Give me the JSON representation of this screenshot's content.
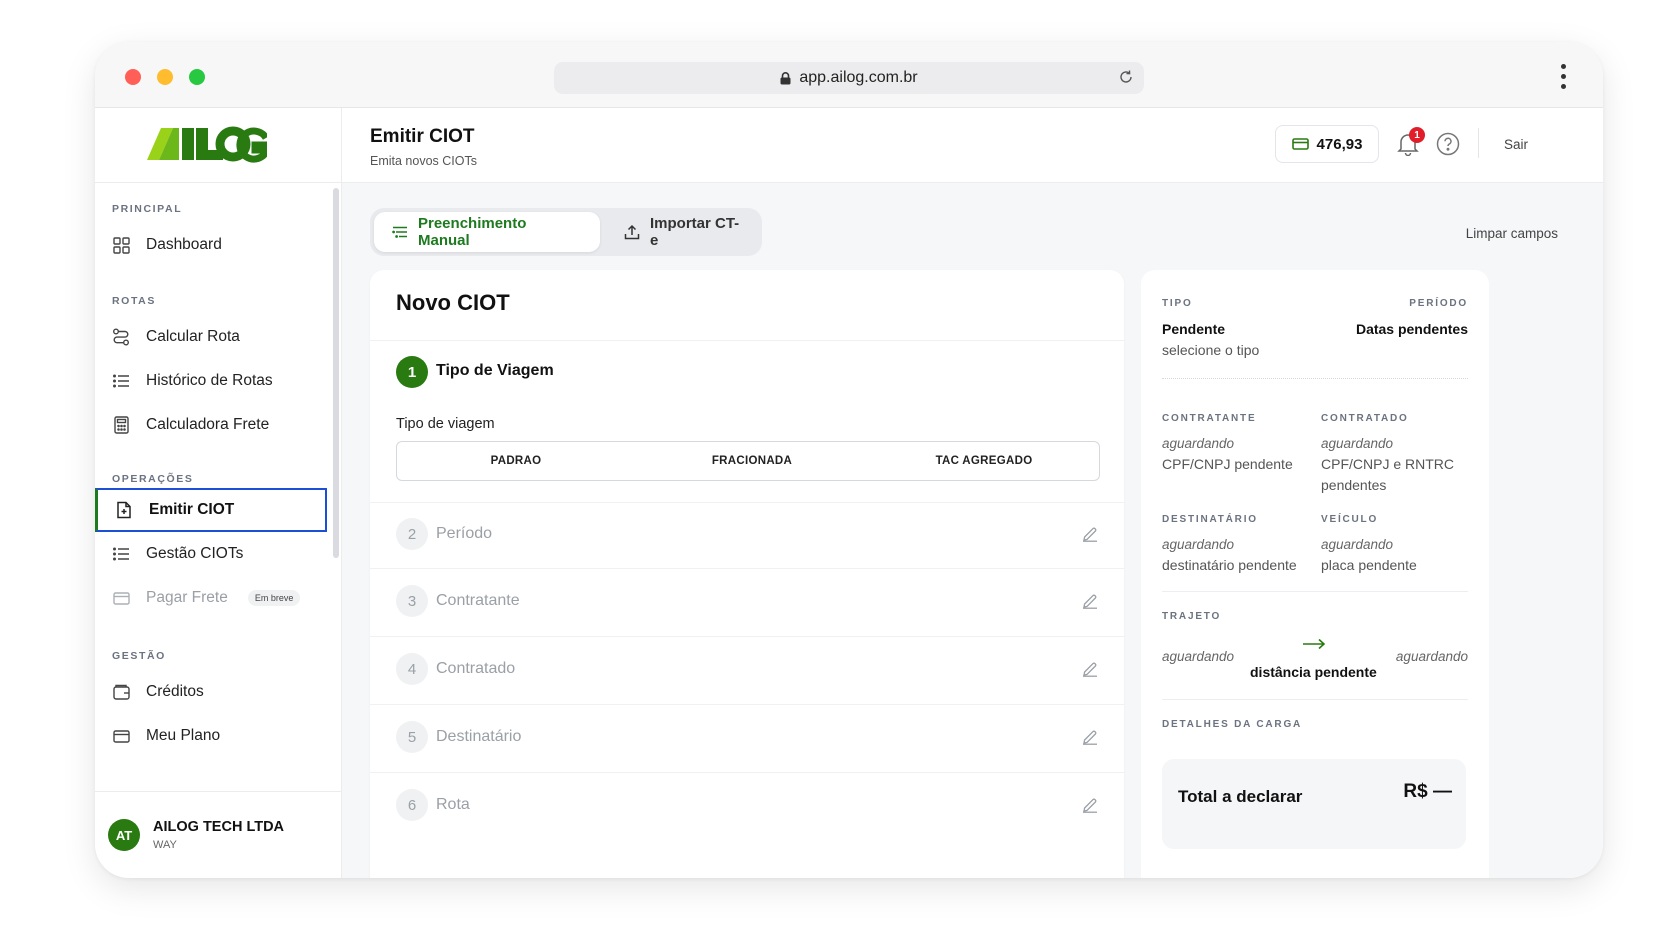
{
  "browser": {
    "url": "app.ailog.com.br"
  },
  "brand": {
    "logo_text": "AILOG",
    "green": "#2a7a12",
    "lime": "#9ad21a"
  },
  "sidebar": {
    "sections": {
      "principal": "PRINCIPAL",
      "rotas": "ROTAS",
      "operacoes": "OPERAÇÕES",
      "gestao": "GESTÃO"
    },
    "items": [
      {
        "label": "Dashboard",
        "icon": "grid-icon"
      },
      {
        "label": "Calcular Rota",
        "icon": "route-icon"
      },
      {
        "label": "Histórico de Rotas",
        "icon": "list-icon"
      },
      {
        "label": "Calculadora Frete",
        "icon": "calculator-icon"
      },
      {
        "label": "Emitir CIOT",
        "icon": "file-plus-icon",
        "active": true
      },
      {
        "label": "Gestão CIOTs",
        "icon": "list-icon"
      },
      {
        "label": "Pagar Frete",
        "icon": "card-icon",
        "disabled": true,
        "badge": "Em breve"
      },
      {
        "label": "Créditos",
        "icon": "wallet-icon"
      },
      {
        "label": "Meu Plano",
        "icon": "card-icon"
      }
    ],
    "org": {
      "initials": "AT",
      "name": "AILOG TECH LTDA",
      "sub": "WAY"
    }
  },
  "header": {
    "title": "Emitir CIOT",
    "subtitle": "Emita novos CIOTs",
    "balance": "476,93",
    "notifications": "1",
    "logout": "Sair"
  },
  "tabs": [
    {
      "label": "Preenchimento Manual",
      "active": true
    },
    {
      "label": "Importar CT-e",
      "active": false
    }
  ],
  "clear_fields": "Limpar campos",
  "form": {
    "title": "Novo CIOT",
    "steps": [
      {
        "number": "1",
        "label": "Tipo de Viagem",
        "active": true
      },
      {
        "number": "2",
        "label": "Período"
      },
      {
        "number": "3",
        "label": "Contratante"
      },
      {
        "number": "4",
        "label": "Contratado"
      },
      {
        "number": "5",
        "label": "Destinatário"
      },
      {
        "number": "6",
        "label": "Rota"
      }
    ],
    "trip_type_label": "Tipo de viagem",
    "trip_type_options": [
      "PADRAO",
      "FRACIONADA",
      "TAC AGREGADO"
    ]
  },
  "summary": {
    "tipo_label": "TIPO",
    "tipo_value": "Pendente",
    "tipo_hint": "selecione o tipo",
    "periodo_label": "PERÍODO",
    "periodo_value": "Datas pendentes",
    "contratante_label": "CONTRATANTE",
    "contratante_status": "aguardando",
    "contratante_value": "CPF/CNPJ pendente",
    "contratado_label": "CONTRATADO",
    "contratado_status": "aguardando",
    "contratado_value_1": "CPF/CNPJ e RNTRC",
    "contratado_value_2": "pendentes",
    "destinatario_label": "DESTINATÁRIO",
    "destinatario_status": "aguardando",
    "destinatario_value": "destinatário pendente",
    "veiculo_label": "VEÍCULO",
    "veiculo_status": "aguardando",
    "veiculo_value": "placa pendente",
    "trajeto_label": "TRAJETO",
    "trajeto_origin": "aguardando",
    "trajeto_destination": "aguardando",
    "trajeto_distance": "distância pendente",
    "carga_label": "DETALHES DA CARGA",
    "total_label": "Total a declarar",
    "total_value": "R$  —"
  }
}
